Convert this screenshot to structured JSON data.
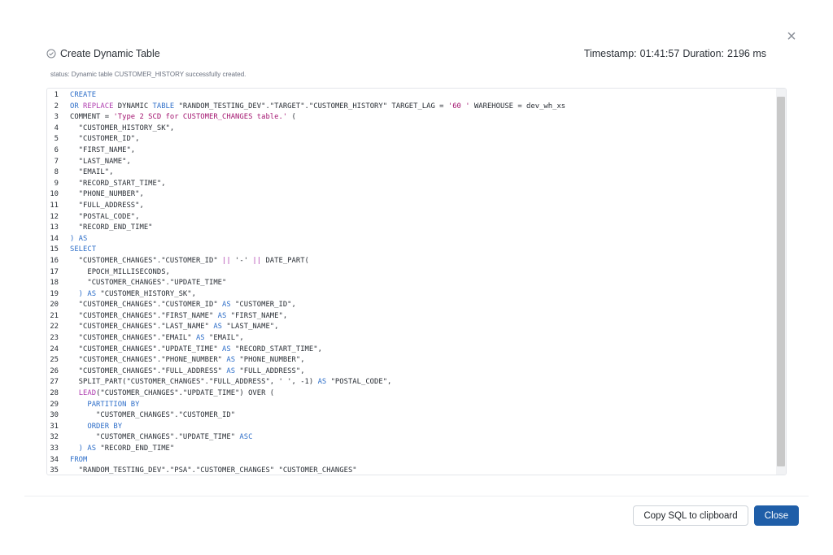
{
  "dialog": {
    "close_glyph": "×",
    "title": "Create Dynamic Table",
    "timestamp_label": "Timestamp:",
    "timestamp_value": "01:41:57",
    "duration_label": "Duration:",
    "duration_value": "2196 ms",
    "status": "status: Dynamic table CUSTOMER_HISTORY successfully created.",
    "copy_button": "Copy SQL to clipboard",
    "close_button": "Close"
  },
  "colors": {
    "keyword": "#2f6fc9",
    "operator": "#b040b0",
    "string": "#a31570",
    "primary": "#1f5ea8"
  },
  "icons": {
    "status": "check-circle-icon",
    "close": "close-icon"
  },
  "code_lines": [
    {
      "n": "1",
      "segs": [
        {
          "t": "CREATE",
          "c": "kw"
        }
      ]
    },
    {
      "n": "2",
      "segs": [
        {
          "t": "OR ",
          "c": "kw"
        },
        {
          "t": "REPLACE",
          "c": "op"
        },
        {
          "t": " DYNAMIC ",
          "c": ""
        },
        {
          "t": "TABLE",
          "c": "kw"
        },
        {
          "t": " \"RANDOM_TESTING_DEV\".\"TARGET\".\"CUSTOMER_HISTORY\" TARGET_LAG = ",
          "c": ""
        },
        {
          "t": "'60 '",
          "c": "str"
        },
        {
          "t": " WAREHOUSE = dev_wh_xs",
          "c": ""
        }
      ]
    },
    {
      "n": "3",
      "segs": [
        {
          "t": "COMMENT = ",
          "c": ""
        },
        {
          "t": "'Type 2 SCD for CUSTOMER_CHANGES table.'",
          "c": "str"
        },
        {
          "t": " (",
          "c": ""
        }
      ]
    },
    {
      "n": "4",
      "segs": [
        {
          "t": "  \"CUSTOMER_HISTORY_SK\",",
          "c": ""
        }
      ]
    },
    {
      "n": "5",
      "segs": [
        {
          "t": "  \"CUSTOMER_ID\",",
          "c": ""
        }
      ]
    },
    {
      "n": "6",
      "segs": [
        {
          "t": "  \"FIRST_NAME\",",
          "c": ""
        }
      ]
    },
    {
      "n": "7",
      "segs": [
        {
          "t": "  \"LAST_NAME\",",
          "c": ""
        }
      ]
    },
    {
      "n": "8",
      "segs": [
        {
          "t": "  \"EMAIL\",",
          "c": ""
        }
      ]
    },
    {
      "n": "9",
      "segs": [
        {
          "t": "  \"RECORD_START_TIME\",",
          "c": ""
        }
      ]
    },
    {
      "n": "10",
      "segs": [
        {
          "t": "  \"PHONE_NUMBER\",",
          "c": ""
        }
      ]
    },
    {
      "n": "11",
      "segs": [
        {
          "t": "  \"FULL_ADDRESS\",",
          "c": ""
        }
      ]
    },
    {
      "n": "12",
      "segs": [
        {
          "t": "  \"POSTAL_CODE\",",
          "c": ""
        }
      ]
    },
    {
      "n": "13",
      "segs": [
        {
          "t": "  \"RECORD_END_TIME\"",
          "c": ""
        }
      ]
    },
    {
      "n": "14",
      "segs": [
        {
          "t": ") AS",
          "c": "kw"
        }
      ]
    },
    {
      "n": "15",
      "segs": [
        {
          "t": "SELECT",
          "c": "kw"
        }
      ]
    },
    {
      "n": "16",
      "segs": [
        {
          "t": "  \"CUSTOMER_CHANGES\".\"CUSTOMER_ID\" ",
          "c": ""
        },
        {
          "t": "||",
          "c": "op"
        },
        {
          "t": " '-' ",
          "c": ""
        },
        {
          "t": "||",
          "c": "op"
        },
        {
          "t": " DATE_PART(",
          "c": ""
        }
      ]
    },
    {
      "n": "17",
      "segs": [
        {
          "t": "    EPOCH_MILLISECONDS,",
          "c": ""
        }
      ]
    },
    {
      "n": "18",
      "segs": [
        {
          "t": "    \"CUSTOMER_CHANGES\".\"UPDATE_TIME\"",
          "c": ""
        }
      ]
    },
    {
      "n": "19",
      "segs": [
        {
          "t": "  ) AS ",
          "c": "kw"
        },
        {
          "t": "\"CUSTOMER_HISTORY_SK\",",
          "c": ""
        }
      ]
    },
    {
      "n": "20",
      "segs": [
        {
          "t": "  \"CUSTOMER_CHANGES\".\"CUSTOMER_ID\" ",
          "c": ""
        },
        {
          "t": "AS",
          "c": "kw"
        },
        {
          "t": " \"CUSTOMER_ID\",",
          "c": ""
        }
      ]
    },
    {
      "n": "21",
      "segs": [
        {
          "t": "  \"CUSTOMER_CHANGES\".\"FIRST_NAME\" ",
          "c": ""
        },
        {
          "t": "AS",
          "c": "kw"
        },
        {
          "t": " \"FIRST_NAME\",",
          "c": ""
        }
      ]
    },
    {
      "n": "22",
      "segs": [
        {
          "t": "  \"CUSTOMER_CHANGES\".\"LAST_NAME\" ",
          "c": ""
        },
        {
          "t": "AS",
          "c": "kw"
        },
        {
          "t": " \"LAST_NAME\",",
          "c": ""
        }
      ]
    },
    {
      "n": "23",
      "segs": [
        {
          "t": "  \"CUSTOMER_CHANGES\".\"EMAIL\" ",
          "c": ""
        },
        {
          "t": "AS",
          "c": "kw"
        },
        {
          "t": " \"EMAIL\",",
          "c": ""
        }
      ]
    },
    {
      "n": "24",
      "segs": [
        {
          "t": "  \"CUSTOMER_CHANGES\".\"UPDATE_TIME\" ",
          "c": ""
        },
        {
          "t": "AS",
          "c": "kw"
        },
        {
          "t": " \"RECORD_START_TIME\",",
          "c": ""
        }
      ]
    },
    {
      "n": "25",
      "segs": [
        {
          "t": "  \"CUSTOMER_CHANGES\".\"PHONE_NUMBER\" ",
          "c": ""
        },
        {
          "t": "AS",
          "c": "kw"
        },
        {
          "t": " \"PHONE_NUMBER\",",
          "c": ""
        }
      ]
    },
    {
      "n": "26",
      "segs": [
        {
          "t": "  \"CUSTOMER_CHANGES\".\"FULL_ADDRESS\" ",
          "c": ""
        },
        {
          "t": "AS",
          "c": "kw"
        },
        {
          "t": " \"FULL_ADDRESS\",",
          "c": ""
        }
      ]
    },
    {
      "n": "27",
      "segs": [
        {
          "t": "  SPLIT_PART(\"CUSTOMER_CHANGES\".\"FULL_ADDRESS\", ' ', -1) ",
          "c": ""
        },
        {
          "t": "AS",
          "c": "kw"
        },
        {
          "t": " \"POSTAL_CODE\",",
          "c": ""
        }
      ]
    },
    {
      "n": "28",
      "segs": [
        {
          "t": "  ",
          "c": ""
        },
        {
          "t": "LEAD",
          "c": "op"
        },
        {
          "t": "(\"CUSTOMER_CHANGES\".\"UPDATE_TIME\") OVER (",
          "c": ""
        }
      ]
    },
    {
      "n": "29",
      "segs": [
        {
          "t": "    PARTITION BY",
          "c": "kw"
        }
      ]
    },
    {
      "n": "30",
      "segs": [
        {
          "t": "      \"CUSTOMER_CHANGES\".\"CUSTOMER_ID\"",
          "c": ""
        }
      ]
    },
    {
      "n": "31",
      "segs": [
        {
          "t": "    ORDER BY",
          "c": "kw"
        }
      ]
    },
    {
      "n": "32",
      "segs": [
        {
          "t": "      \"CUSTOMER_CHANGES\".\"UPDATE_TIME\" ",
          "c": ""
        },
        {
          "t": "ASC",
          "c": "kw"
        }
      ]
    },
    {
      "n": "33",
      "segs": [
        {
          "t": "  ) AS ",
          "c": "kw"
        },
        {
          "t": "\"RECORD_END_TIME\"",
          "c": ""
        }
      ]
    },
    {
      "n": "34",
      "segs": [
        {
          "t": "FROM",
          "c": "kw"
        }
      ]
    },
    {
      "n": "35",
      "segs": [
        {
          "t": "  \"RANDOM_TESTING_DEV\".\"PSA\".\"CUSTOMER_CHANGES\" \"CUSTOMER_CHANGES\"",
          "c": ""
        }
      ]
    }
  ]
}
